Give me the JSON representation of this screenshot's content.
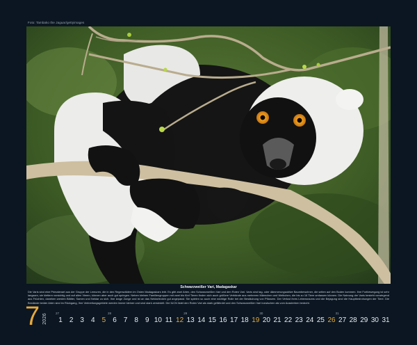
{
  "credit": "Foto: Tambako the Jaguar/gettyimages",
  "caption": {
    "title": "Schwarzweißer Vari, Madagaskar",
    "text": "Die Varis sind eine Primatenart aus der Gruppe der Lemuren, die in den Regenwäldern im Osten Madagaskars lebt. Es gibt zwei Arten, den Schwarzweißen Vari und den Roten Vari. Varis sind tag- oder dämmerungsaktive Baumbewohner, die selten auf den Boden kommen. Ihre Fortbewegung ist sehr langsam, sie klettern vorsichtig und auf allen Vieren, können aber auch gut springen. Neben kleinen Familiengruppen mit zwei bis fünf Tieren finden sich auch größere Verbände aus mehreren Männchen und Weibchen, die bis zu 16 Tiere umfassen können. Die Nahrung der Varis besteht vorwiegend aus Früchten, daneben werden Blätter, Samen und Nektar zu sich. Ihre lange Zunge und ist an das Nektarlecken gut angepasst. Sie spielen so auch eine wichtige Rolle bei der Bestäubung von Pflanzen. Der Verlust ihres Lebensraums und die Bejagung sind die Hauptbedrohungen der Tiere. Die Bestände beider Arten sind im Rückgang, Ihre Verbreitungsgebiete werden immer kleiner und sind stark zersiedelt. Die IUCN listet den Roten Vari als stark gefährdet und den Schwarzweißen Vari inzwischen als vom Aussterben bedroht."
  },
  "calendar": {
    "month": "7",
    "year": "2026",
    "days": [
      {
        "d": "1",
        "sun": false
      },
      {
        "d": "2",
        "sun": false
      },
      {
        "d": "3",
        "sun": false
      },
      {
        "d": "4",
        "sun": false
      },
      {
        "d": "5",
        "sun": true
      },
      {
        "d": "6",
        "sun": false,
        "week": "28"
      },
      {
        "d": "7",
        "sun": false
      },
      {
        "d": "8",
        "sun": false
      },
      {
        "d": "9",
        "sun": false
      },
      {
        "d": "10",
        "sun": false
      },
      {
        "d": "11",
        "sun": false
      },
      {
        "d": "12",
        "sun": true
      },
      {
        "d": "13",
        "sun": false,
        "week": "29"
      },
      {
        "d": "14",
        "sun": false
      },
      {
        "d": "15",
        "sun": false
      },
      {
        "d": "16",
        "sun": false
      },
      {
        "d": "17",
        "sun": false
      },
      {
        "d": "18",
        "sun": false
      },
      {
        "d": "19",
        "sun": true
      },
      {
        "d": "20",
        "sun": false,
        "week": "30"
      },
      {
        "d": "21",
        "sun": false
      },
      {
        "d": "22",
        "sun": false
      },
      {
        "d": "23",
        "sun": false
      },
      {
        "d": "24",
        "sun": false
      },
      {
        "d": "25",
        "sun": false
      },
      {
        "d": "26",
        "sun": true
      },
      {
        "d": "27",
        "sun": false,
        "week": "31"
      },
      {
        "d": "28",
        "sun": false
      },
      {
        "d": "29",
        "sun": false
      },
      {
        "d": "30",
        "sun": false
      },
      {
        "d": "31",
        "sun": false
      }
    ],
    "first_week": "27"
  },
  "colors": {
    "background": "#0b1622",
    "accent": "#e6a93b"
  }
}
